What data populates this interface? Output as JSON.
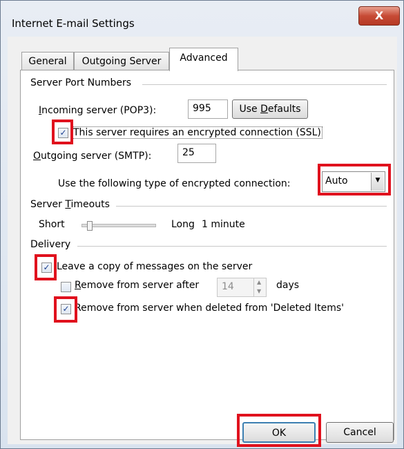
{
  "window": {
    "title": "Internet E-mail Settings",
    "close_label": "X"
  },
  "tabs": [
    {
      "label": "General",
      "active": false
    },
    {
      "label": "Outgoing Server",
      "active": false
    },
    {
      "label": "Advanced",
      "active": true
    }
  ],
  "server_ports": {
    "group_label": "Server Port Numbers",
    "incoming_label": "Incoming server (POP3):",
    "incoming_value": "995",
    "use_defaults_label": "Use Defaults",
    "ssl_checkbox": {
      "label": "This server requires an encrypted connection (SSL)",
      "checked": true
    },
    "outgoing_label": "Outgoing server (SMTP):",
    "outgoing_value": "25",
    "encryption_label": "Use the following type of encrypted connection:",
    "encryption_value": "Auto"
  },
  "timeouts": {
    "group_label": "Server Timeouts",
    "short_label": "Short",
    "long_label": "Long",
    "value_label": "1 minute"
  },
  "delivery": {
    "group_label": "Delivery",
    "leave_copy": {
      "label": "Leave a copy of messages on the server",
      "checked": true
    },
    "remove_after": {
      "label": "Remove from server after",
      "checked": false,
      "value": "14",
      "unit": "days"
    },
    "remove_deleted": {
      "label": "Remove from server when deleted from 'Deleted Items'",
      "checked": true
    }
  },
  "footer": {
    "ok_label": "OK",
    "cancel_label": "Cancel"
  },
  "colors": {
    "highlight": "#e0111d"
  }
}
